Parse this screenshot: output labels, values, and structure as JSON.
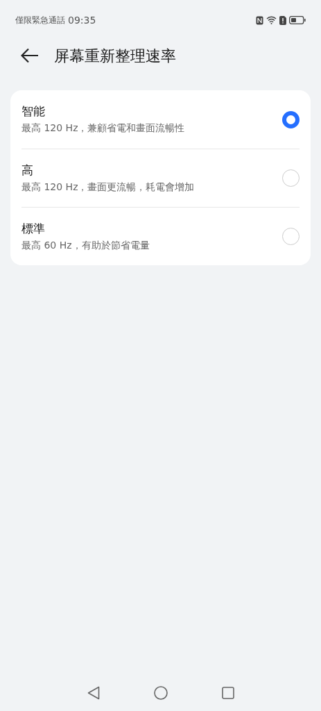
{
  "status_bar": {
    "carrier": "僅限緊急通話",
    "time": "09:35"
  },
  "header": {
    "title": "屏幕重新整理速率"
  },
  "options": [
    {
      "title": "智能",
      "subtitle": "最高 120 Hz，兼顧省電和畫面流暢性",
      "selected": true
    },
    {
      "title": "高",
      "subtitle": "最高 120 Hz，畫面更流暢，耗電會增加",
      "selected": false
    },
    {
      "title": "標準",
      "subtitle": "最高 60 Hz，有助於節省電量",
      "selected": false
    }
  ]
}
